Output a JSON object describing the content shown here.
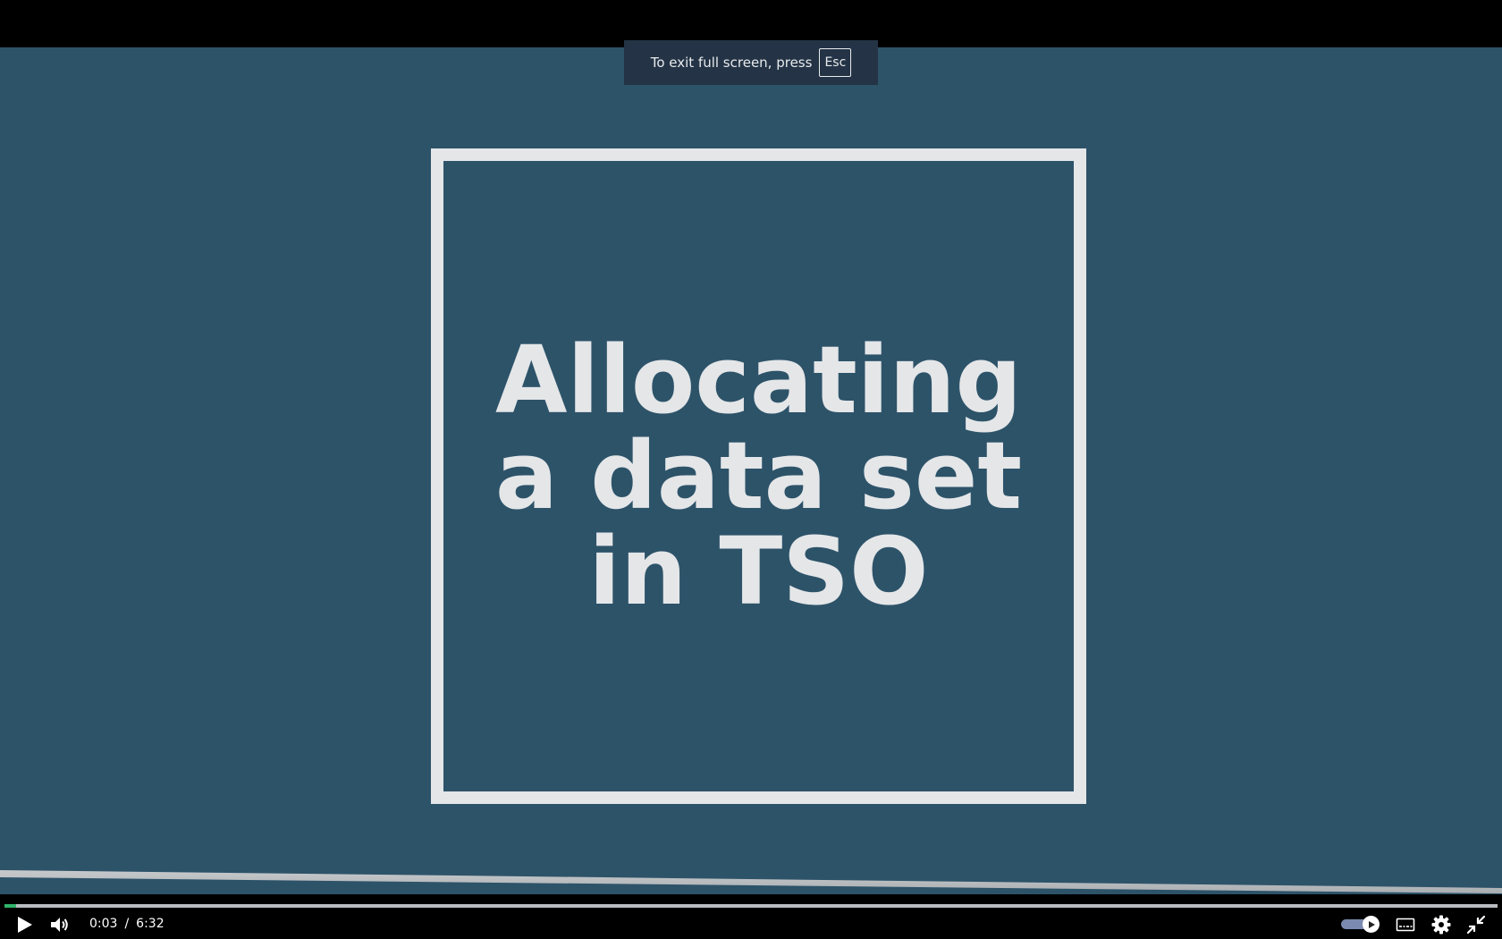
{
  "toast": {
    "message": "To exit full screen, press",
    "key": "Esc"
  },
  "video": {
    "title_lines": [
      "Allocating",
      "a data set",
      "in TSO"
    ],
    "background_color": "#2d5369",
    "text_color": "#e4e6e8"
  },
  "player": {
    "current_time": "0:03",
    "separator": "/",
    "duration": "6:32",
    "progress_fraction": 0.008,
    "progress_color": "#2fb36a",
    "autoplay_on": true,
    "icons": {
      "play": "play-icon",
      "volume": "volume-icon",
      "autoplay": "autoplay-toggle",
      "captions": "captions-icon",
      "settings": "gear-icon",
      "exit_fullscreen": "exit-fullscreen-icon"
    }
  }
}
